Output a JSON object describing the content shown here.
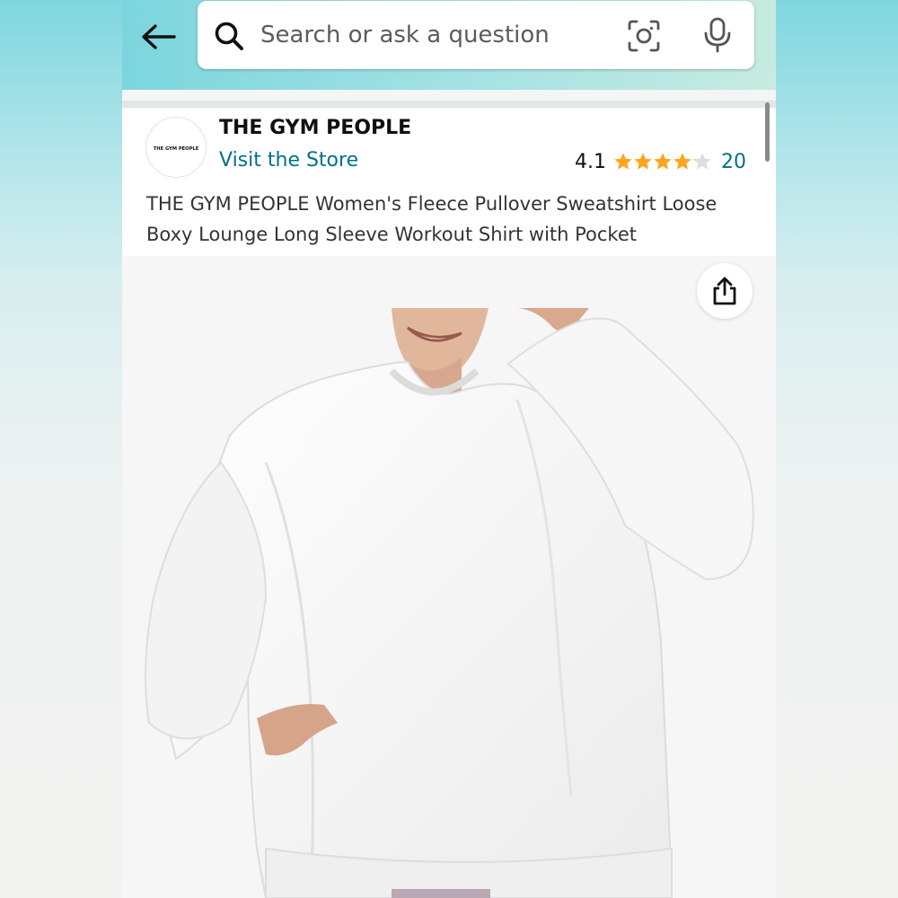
{
  "search": {
    "placeholder": "Search or ask a question",
    "value": ""
  },
  "icons": {
    "back": "arrow-left-icon",
    "search": "magnifier-icon",
    "camera": "camera-lens-icon",
    "mic": "microphone-icon",
    "share": "share-icon",
    "star": "star-icon"
  },
  "brand": {
    "logo_text": "THE GYM PEOPLE",
    "name": "THE GYM PEOPLE",
    "store_link_label": "Visit the Store"
  },
  "rating": {
    "value": "4.1",
    "stars_out_of_five": 4.1,
    "review_count": "20"
  },
  "product": {
    "title": "THE GYM PEOPLE Women's Fleece Pullover Sweatshirt Loose Boxy Lounge Long Sleeve Workout Shirt with Pocket"
  },
  "colors": {
    "header_gradient_start": "#7cd5dd",
    "header_gradient_end": "#c7ebe0",
    "link": "#007185",
    "star_fill": "#ffa41c",
    "star_empty": "#dddddd",
    "text": "#0f1111"
  }
}
